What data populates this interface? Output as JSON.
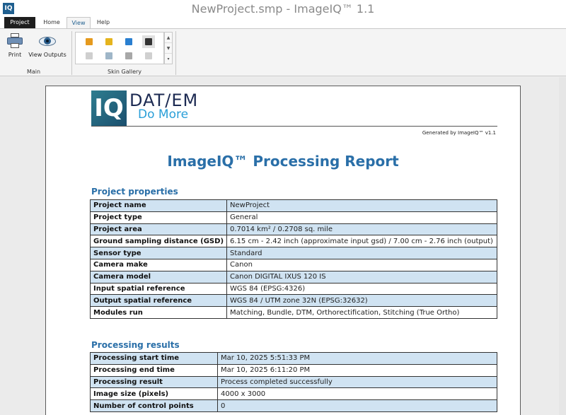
{
  "window": {
    "icon_text": "IQ",
    "title": "NewProject.smp - ImageIQ™ 1.1"
  },
  "tabs": [
    {
      "label": "Project"
    },
    {
      "label": "Home"
    },
    {
      "label": "View"
    },
    {
      "label": "Help"
    }
  ],
  "ribbon": {
    "print_label": "Print",
    "view_outputs_label": "View Outputs",
    "main_group_label": "Main",
    "skin_gallery_label": "Skin Gallery",
    "skins": [
      {
        "name": "skin-1",
        "color": "#e59a1e"
      },
      {
        "name": "skin-2",
        "color": "#e5b41e"
      },
      {
        "name": "skin-3",
        "color": "#2a7fd0"
      },
      {
        "name": "skin-4",
        "color": "#333333"
      },
      {
        "name": "skin-5",
        "color": "#cfcfcf"
      },
      {
        "name": "skin-6",
        "color": "#9fb6c8"
      },
      {
        "name": "skin-7",
        "color": "#a8a8a8"
      },
      {
        "name": "skin-8",
        "color": "#d0d0d0"
      }
    ]
  },
  "report": {
    "logo_iq": "IQ",
    "logo_company": "DAT/EM",
    "logo_tagline": "Do More",
    "generated_by": "Generated by ImageIQ™ v1.1",
    "title": "ImageIQ™ Processing Report",
    "project_properties": {
      "heading": "Project properties",
      "rows": [
        {
          "key": "Project name",
          "value": "NewProject"
        },
        {
          "key": "Project type",
          "value": "General"
        },
        {
          "key": "Project area",
          "value": "0.7014 km²   /   0.2708 sq. mile"
        },
        {
          "key": "Ground sampling distance (GSD)",
          "value": "6.15 cm - 2.42 inch (approximate input gsd)   /   7.00 cm - 2.76 inch (output)"
        },
        {
          "key": "Sensor type",
          "value": "Standard"
        },
        {
          "key": "Camera make",
          "value": "Canon"
        },
        {
          "key": "Camera model",
          "value": "Canon DIGITAL IXUS 120 IS"
        },
        {
          "key": "Input spatial reference",
          "value": "WGS 84 (EPSG:4326)"
        },
        {
          "key": "Output spatial reference",
          "value": "WGS 84 / UTM zone 32N (EPSG:32632)"
        },
        {
          "key": "Modules run",
          "value": "Matching, Bundle, DTM, Orthorectification, Stitching (True Ortho)"
        }
      ]
    },
    "processing_results": {
      "heading": "Processing results",
      "rows": [
        {
          "key": "Processing start time",
          "value": "Mar 10, 2025  5:51:33 PM"
        },
        {
          "key": "Processing end time",
          "value": "Mar 10, 2025  6:11:20 PM"
        },
        {
          "key": "Processing result",
          "value": "Process completed successfully"
        },
        {
          "key": "Image size (pixels)",
          "value": "4000 x 3000"
        },
        {
          "key": "Number of control points",
          "value": "0"
        }
      ]
    }
  }
}
